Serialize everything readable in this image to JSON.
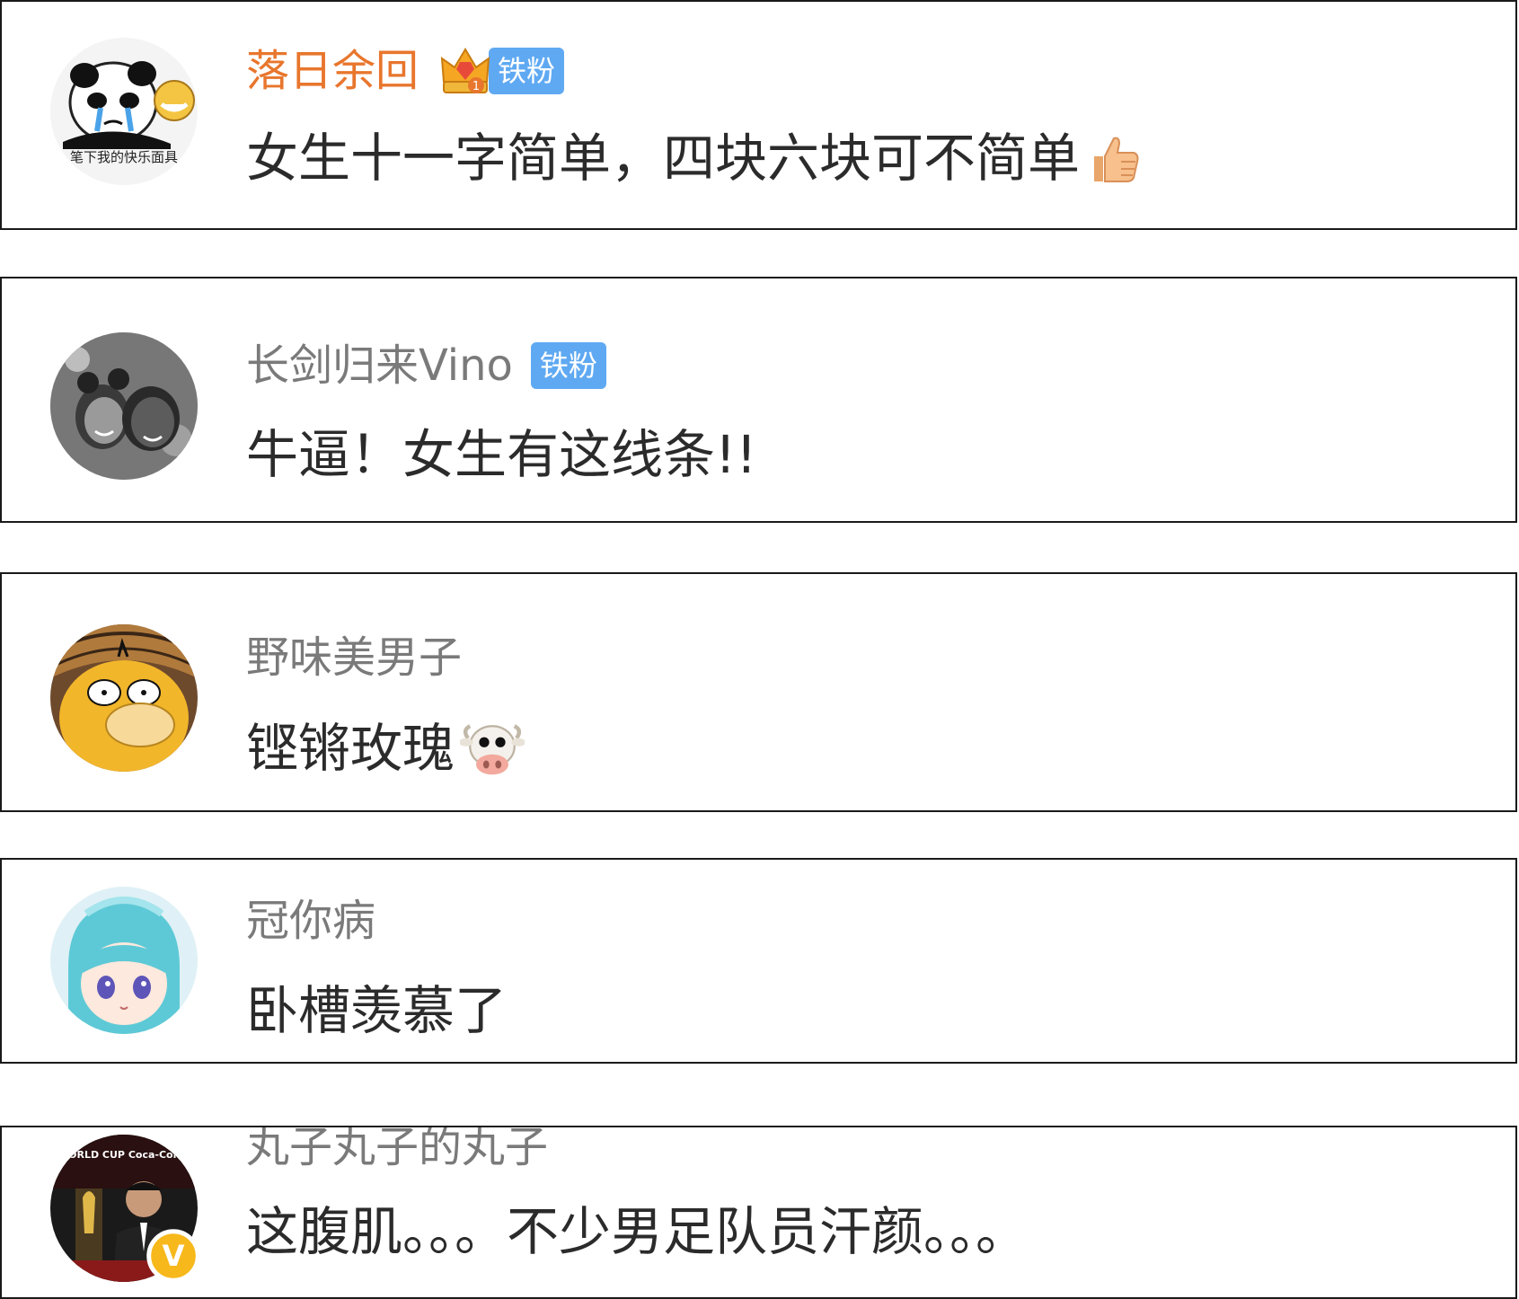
{
  "comments": [
    {
      "username": "落日余回",
      "badge": "铁粉",
      "crown_level": "1",
      "text": "女生十一字简单，四块六块可不简单",
      "avatar_caption": "笔下我的快乐面具",
      "emoji": "thumbs-up-emoji"
    },
    {
      "username": "长剑归来Vino",
      "badge": "铁粉",
      "text": "牛逼！女生有这线条!!"
    },
    {
      "username": "野味美男子",
      "text": "铿锵玫瑰",
      "emoji": "cow-face-emoji"
    },
    {
      "username": "冠你病",
      "text": "卧槽羡慕了"
    },
    {
      "username": "丸子丸子的丸子",
      "text": "这腹肌。。。不少男足队员汗颜。。。",
      "avatar_caption": "WORLD CUP Coca-Cola",
      "verified_mark": "V"
    }
  ],
  "colors": {
    "vip_name": "#e8762d",
    "name": "#7a7a7a",
    "comment_text": "#2b2b2b",
    "fan_badge": "#5fa9f2",
    "card_border": "#1a1a1a"
  }
}
